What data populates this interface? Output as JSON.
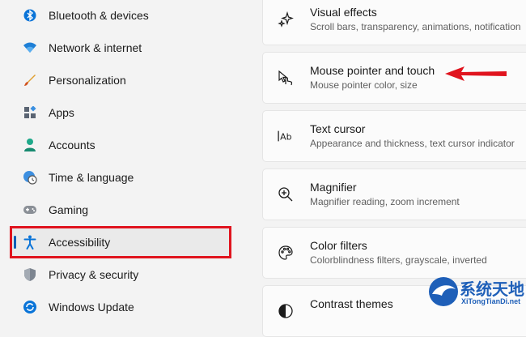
{
  "sidebar": {
    "items": [
      {
        "label": "Bluetooth & devices",
        "icon": "bluetooth-icon"
      },
      {
        "label": "Network & internet",
        "icon": "wifi-icon"
      },
      {
        "label": "Personalization",
        "icon": "brush-icon"
      },
      {
        "label": "Apps",
        "icon": "apps-icon"
      },
      {
        "label": "Accounts",
        "icon": "person-icon"
      },
      {
        "label": "Time & language",
        "icon": "globe-clock-icon"
      },
      {
        "label": "Gaming",
        "icon": "gamepad-icon"
      },
      {
        "label": "Accessibility",
        "icon": "accessibility-icon",
        "selected": true
      },
      {
        "label": "Privacy & security",
        "icon": "shield-icon"
      },
      {
        "label": "Windows Update",
        "icon": "update-icon"
      }
    ],
    "accent": "#005fb8",
    "highlight_color": "#e0141e"
  },
  "main": {
    "cards": [
      {
        "title": "Visual effects",
        "description": "Scroll bars, transparency, animations, notification",
        "icon": "sparkle-icon"
      },
      {
        "title": "Mouse pointer and touch",
        "description": "Mouse pointer color, size",
        "icon": "pointer-touch-icon"
      },
      {
        "title": "Text cursor",
        "description": "Appearance and thickness, text cursor indicator",
        "icon": "text-cursor-icon"
      },
      {
        "title": "Magnifier",
        "description": "Magnifier reading, zoom increment",
        "icon": "magnifier-icon"
      },
      {
        "title": "Color filters",
        "description": "Colorblindness filters, grayscale, inverted",
        "icon": "palette-icon"
      },
      {
        "title": "Contrast themes",
        "description": "",
        "icon": "contrast-icon"
      }
    ],
    "arrow_color": "#e0141e"
  },
  "watermark": {
    "title": "系统天地",
    "subtitle": "XiTongTianDi.net"
  }
}
